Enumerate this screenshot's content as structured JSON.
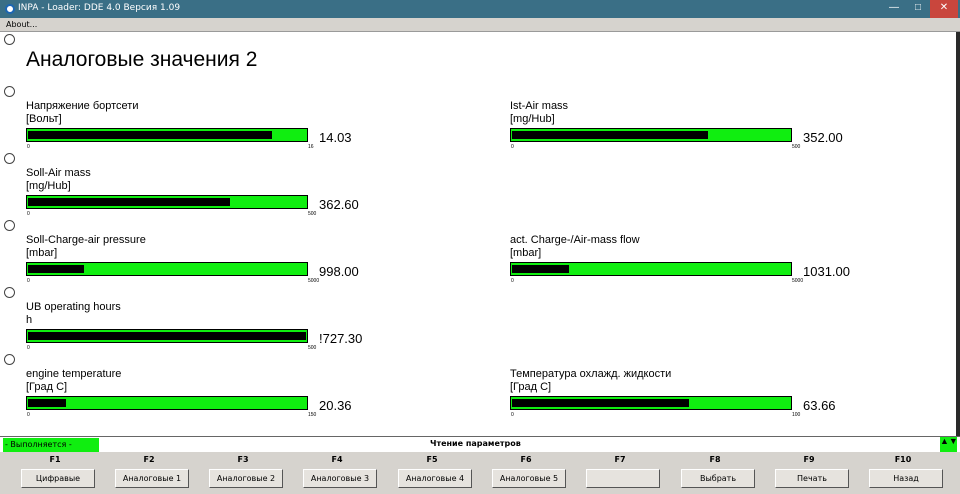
{
  "window": {
    "title": "INPA - Loader:  DDE 4.0 Версия 1.09",
    "minimize_glyph": "—",
    "maximize_glyph": "□",
    "close_glyph": "✕"
  },
  "menu": {
    "about": "About..."
  },
  "page_title": "Аналоговые значения 2",
  "gauges": [
    {
      "label": "Напряжение бортсети",
      "unit": "[Вольт]",
      "min": "0",
      "max": "16",
      "value": "14.03",
      "fill_fraction": 0.877
    },
    {
      "label": "Ist-Air mass",
      "unit": "[mg/Hub]",
      "min": "0",
      "max": "500",
      "value": "352.00",
      "fill_fraction": 0.704
    },
    {
      "label": "Soll-Air mass",
      "unit": "[mg/Hub]",
      "min": "0",
      "max": "500",
      "value": "362.60",
      "fill_fraction": 0.725
    },
    {
      "label": "Soll-Charge-air pressure",
      "unit": "[mbar]",
      "min": "0",
      "max": "5000",
      "value": "998.00",
      "fill_fraction": 0.2
    },
    {
      "label": "act. Charge-/Air-mass flow",
      "unit": "[mbar]",
      "min": "0",
      "max": "5000",
      "value": "1031.00",
      "fill_fraction": 0.206
    },
    {
      "label": "UB operating hours",
      "unit": "h",
      "min": "0",
      "max": "500",
      "value": "!727.30",
      "fill_fraction": 1.0
    },
    {
      "label": "engine temperature",
      "unit": "[Град С]",
      "min": "0",
      "max": "150",
      "value": "20.36",
      "fill_fraction": 0.136
    },
    {
      "label": "Температура охлажд. жидкости",
      "unit": "[Град С]",
      "min": "0",
      "max": "100",
      "value": "63.66",
      "fill_fraction": 0.637
    }
  ],
  "status": {
    "state": "- Выполняется -",
    "message": "Чтение параметров",
    "arrows_glyph": "▲▼"
  },
  "fkeys": [
    {
      "key": "F1",
      "label": "Цифравые"
    },
    {
      "key": "F2",
      "label": "Аналоговые 1"
    },
    {
      "key": "F3",
      "label": "Аналоговые 2"
    },
    {
      "key": "F4",
      "label": "Аналоговые 3"
    },
    {
      "key": "F5",
      "label": "Аналоговые 4"
    },
    {
      "key": "F6",
      "label": "Аналоговые 5"
    },
    {
      "key": "F7",
      "label": ""
    },
    {
      "key": "F8",
      "label": "Выбрать"
    },
    {
      "key": "F9",
      "label": "Печать"
    },
    {
      "key": "F10",
      "label": "Назад"
    }
  ],
  "colors": {
    "bar_green": "#10ee10",
    "bar_fill": "#000000",
    "titlebar": "#3a6f86",
    "close": "#c9463d"
  }
}
